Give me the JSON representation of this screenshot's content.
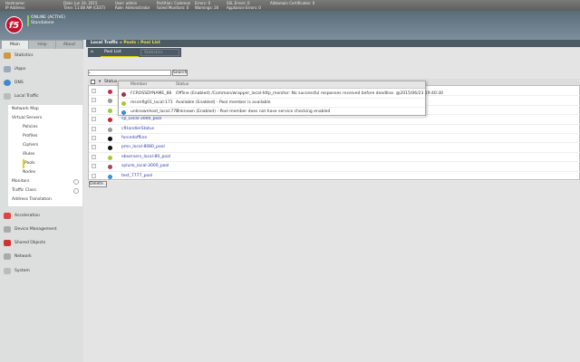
{
  "topbar": {
    "hostname_label": "Hostname:",
    "ip_label": "IP Address:",
    "date": "Date: Jun 24, 2015",
    "time": "Time: 11:08 AM (CEST)",
    "user": "User: admin",
    "role": "Role: Administrator",
    "partition": "Partition: Common",
    "failed_monitors": "Failed Monitors: 0",
    "errors": "Errors: 0",
    "warnings": "Warnings: 26",
    "ssl_errors": "SSL Errors: 0",
    "appliance_errors": "Appliance Errors: 0",
    "additional": "Alldomain Certificates: 0"
  },
  "header": {
    "logo": "f5",
    "status_line1": "ONLINE (ACTIVE)",
    "status_line2": "Standalone"
  },
  "nav_tabs": [
    "Main",
    "Help",
    "About"
  ],
  "breadcrumb": {
    "section": "Local Traffic",
    "sep": "»",
    "page": "Pools : Pool List"
  },
  "sub_tabs": {
    "home": "⌂",
    "pool_list": "Pool List",
    "statistics": "Statistics"
  },
  "sidebar": {
    "top": [
      "Statistics",
      "iApps",
      "DNS",
      "Local Traffic"
    ],
    "submenu": [
      {
        "label": "Network Map",
        "indent": false
      },
      {
        "label": "Virtual Servers",
        "indent": false
      },
      {
        "label": "Policies",
        "indent": true
      },
      {
        "label": "Profiles",
        "indent": true
      },
      {
        "label": "Ciphers",
        "indent": true
      },
      {
        "label": "iRules",
        "indent": true
      },
      {
        "label": "Pools",
        "indent": true,
        "active": true
      },
      {
        "label": "Nodes",
        "indent": true
      },
      {
        "label": "Monitors",
        "indent": false,
        "plus": true
      },
      {
        "label": "Traffic Class",
        "indent": false,
        "plus": true
      },
      {
        "label": "Address Translation",
        "indent": false
      }
    ],
    "bottom": [
      "Acceleration",
      "Device Management",
      "Shared Objects",
      "Network",
      "System"
    ]
  },
  "search": {
    "value": "*",
    "button": "Search"
  },
  "table": {
    "status_header": "Status",
    "name_header": "Name",
    "rows": [
      {
        "name": "",
        "status": "#c03050"
      },
      {
        "name": "",
        "status": "#999999"
      },
      {
        "name": "",
        "status": "#9c3"
      },
      {
        "name": "cp_Local-3000_pool",
        "status": "#d02040"
      },
      {
        "name": "cfHandlerStatus",
        "status": "#999999"
      },
      {
        "name": "forcedoffline",
        "status": "#111111"
      },
      {
        "name": "pmn_local-8080_pool",
        "status": "#111111"
      },
      {
        "name": "observers_local-80_pool",
        "status": "#a8c832"
      },
      {
        "name": "splunk_local-3000_pool",
        "status": "#b04060"
      },
      {
        "name": "test_7777_pool",
        "status": "#3c8fd0"
      }
    ],
    "delete_button": "Delete..."
  },
  "popup": {
    "member_header": "Member",
    "status_header": "Status",
    "rows": [
      {
        "member": "FCROSSDYNAME_88",
        "status": "Offline (Enabled) /Common/wrapper_local-http_monitor: No successful responses received before deadline. @2015/06/23 19:40:30",
        "color": "#a03050"
      },
      {
        "member": "mconfig01_local:171",
        "status": "Available (Enabled) - Pool member is available",
        "color": "#a8c832"
      },
      {
        "member": "unknownhost_local:777",
        "status": "Unknown (Enabled) - Pool member does not have service checking enabled",
        "color": "#3c8fd0"
      }
    ]
  }
}
